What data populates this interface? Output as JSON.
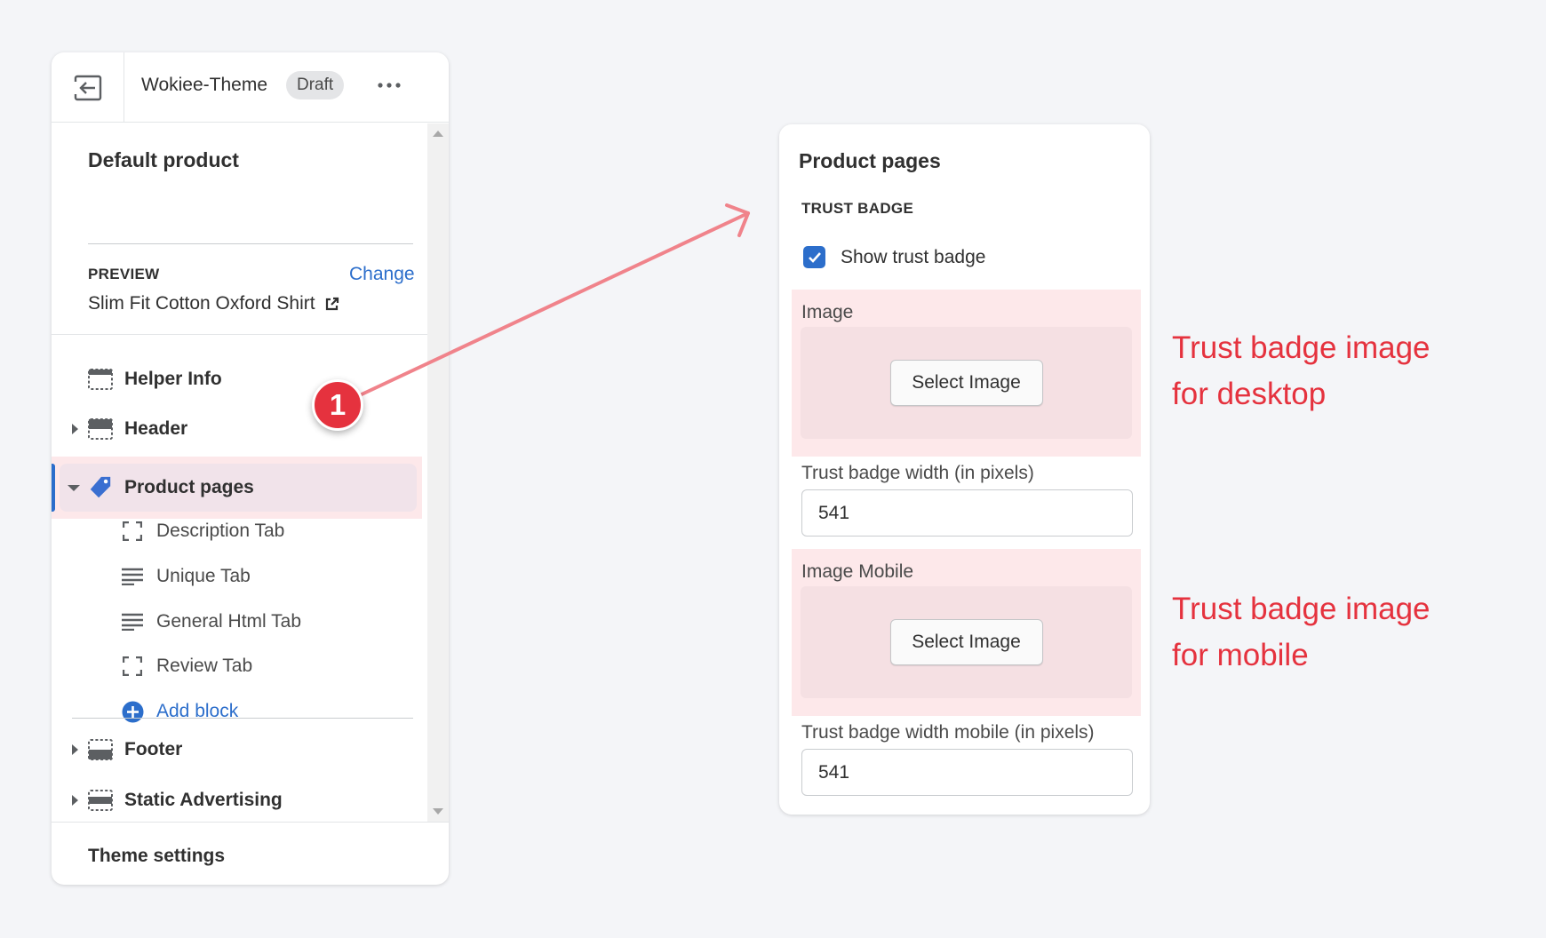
{
  "editor": {
    "theme_name": "Wokiee-Theme",
    "status_badge": "Draft",
    "template_title": "Default product",
    "preview_label": "PREVIEW",
    "change_label": "Change",
    "preview_product": "Slim Fit Cotton Oxford Shirt",
    "sections": [
      {
        "label": "Helper Info",
        "icon": "section-icon"
      },
      {
        "label": "Header",
        "icon": "header-icon"
      },
      {
        "label": "Product pages",
        "icon": "tag-icon"
      },
      {
        "label": "Footer",
        "icon": "footer-icon"
      },
      {
        "label": "Static Advertising",
        "icon": "section-icon"
      }
    ],
    "blocks": [
      {
        "label": "Description Tab",
        "icon": "block-icon"
      },
      {
        "label": "Unique Tab",
        "icon": "text-lines-icon"
      },
      {
        "label": "General Html Tab",
        "icon": "text-lines-icon"
      },
      {
        "label": "Review Tab",
        "icon": "block-icon"
      }
    ],
    "add_block_label": "Add block",
    "theme_settings_label": "Theme settings"
  },
  "callout": {
    "step": "1"
  },
  "settings": {
    "title": "Product pages",
    "section_heading": "TRUST BADGE",
    "show_badge_label": "Show trust badge",
    "show_badge_checked": true,
    "image_label": "Image",
    "select_image_label": "Select Image",
    "width_label": "Trust badge width (in pixels)",
    "width_value": "541",
    "image_mobile_label": "Image Mobile",
    "width_mobile_label": "Trust badge width mobile (in pixels)",
    "width_mobile_value": "541"
  },
  "annotations": {
    "desktop_line1": "Trust badge image",
    "desktop_line2": "for desktop",
    "mobile_line1": "Trust badge image",
    "mobile_line2": "for mobile"
  },
  "colors": {
    "accent": "#2c6ecb",
    "highlight": "#fde8ea",
    "annotation": "#e5323e",
    "arrow": "#f0838b"
  }
}
